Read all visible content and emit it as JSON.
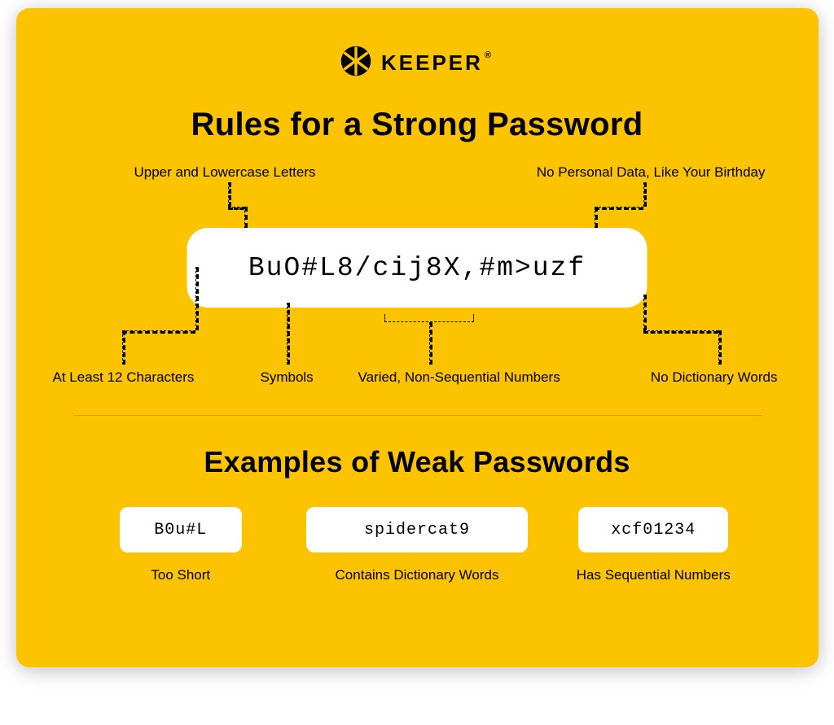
{
  "brand": {
    "name": "KEEPER",
    "registered": "®"
  },
  "title": "Rules for a Strong Password",
  "strong": {
    "password": "BuO#L8/cij8X,#m>uzf",
    "rules": {
      "upper_lower": "Upper and Lowercase Letters",
      "no_personal": "No Personal Data, Like Your Birthday",
      "length": "At Least 12 Characters",
      "symbols": "Symbols",
      "varied_numbers": "Varied, Non-Sequential Numbers",
      "no_dictionary": "No Dictionary Words"
    }
  },
  "weak": {
    "heading": "Examples of Weak Passwords",
    "examples": [
      {
        "pw": "B0u#L",
        "reason": "Too Short"
      },
      {
        "pw": "spidercat9",
        "reason": "Contains Dictionary Words"
      },
      {
        "pw": "xcf01234",
        "reason": "Has Sequential Numbers"
      }
    ]
  }
}
